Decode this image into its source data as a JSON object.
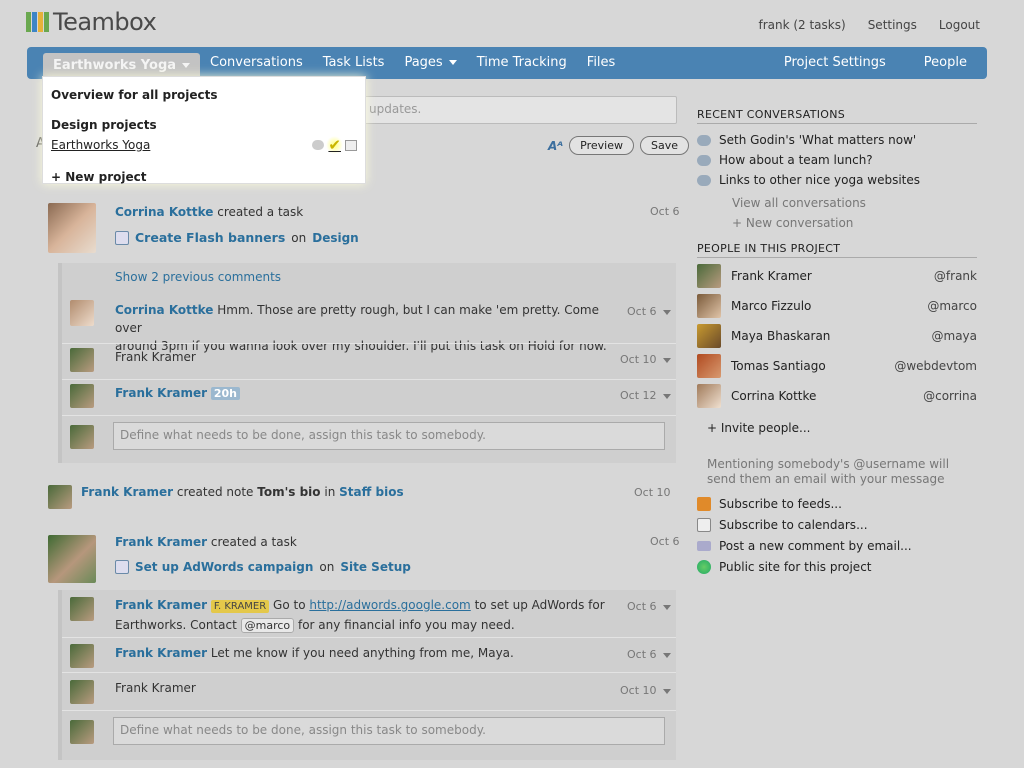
{
  "app": {
    "title": "Teambox"
  },
  "topnav": {
    "user": "frank (2 tasks)",
    "settings": "Settings",
    "logout": "Logout"
  },
  "nav": {
    "project": "Earthworks Yoga",
    "items": [
      "Conversations",
      "Task Lists",
      "Pages",
      "Time Tracking",
      "Files"
    ],
    "right": [
      "Project Settings",
      "People"
    ]
  },
  "dropdown": {
    "overview": "Overview for all projects",
    "group": "Design projects",
    "project": "Earthworks Yoga",
    "new_project": "+ New project"
  },
  "status_input": {
    "placeholder": "updates."
  },
  "buttons": {
    "aa": "Aᴬ",
    "preview": "Preview",
    "save": "Save"
  },
  "feed": {
    "a1": {
      "who": "Corrina Kottke",
      "action": "created a task",
      "date": "Oct 6",
      "task": "Create Flash banners",
      "on": "on",
      "project": "Design"
    },
    "a1_comments": {
      "show_prev": "Show 2 previous comments",
      "c1": {
        "who": "Corrina Kottke",
        "text": "Hmm. Those are pretty rough, but I can make 'em pretty. Come over",
        "text2": "around 3pm if you wanna look over my shoulder. I'll put this task on Hold for now.",
        "date": "Oct 6"
      },
      "c2": {
        "who": "Frank Kramer",
        "date": "Oct 10"
      },
      "c3": {
        "who": "Frank Kramer",
        "badge": "20h",
        "date": "Oct 12"
      },
      "placeholder": "Define what needs to be done, assign this task to somebody."
    },
    "a2": {
      "who": "Frank Kramer",
      "action": "created note",
      "note": "Tom's bio",
      "in": "in",
      "where": "Staff bios",
      "date": "Oct 10"
    },
    "a3": {
      "who": "Frank Kramer",
      "action": "created a task",
      "date": "Oct 6",
      "task": "Set up AdWords campaign",
      "on": "on",
      "project": "Site Setup"
    },
    "a3_comments": {
      "c1": {
        "who": "Frank Kramer",
        "tag": "F. KRAMER",
        "pre": "Go to",
        "link": "http://adwords.google.com",
        "post": "to set up AdWords for",
        "line2a": "Earthworks. Contact",
        "mention": "@marco",
        "line2b": "for any financial info you may need.",
        "date": "Oct 6"
      },
      "c2": {
        "who": "Frank Kramer",
        "text": "Let me know if you need anything from me, Maya.",
        "date": "Oct 6"
      },
      "c3": {
        "who": "Frank Kramer",
        "date": "Oct 10"
      },
      "placeholder": "Define what needs to be done, assign this task to somebody."
    }
  },
  "sidebar": {
    "recent_title": "RECENT CONVERSATIONS",
    "conversations": [
      "Seth Godin's 'What matters now'",
      "How about a team lunch?",
      "Links to other nice yoga websites"
    ],
    "view_all": "View all conversations",
    "new_conv": "+ New conversation",
    "people_title": "PEOPLE IN THIS PROJECT",
    "people": [
      {
        "name": "Frank Kramer",
        "user": "@frank"
      },
      {
        "name": "Marco Fizzulo",
        "user": "@marco"
      },
      {
        "name": "Maya Bhaskaran",
        "user": "@maya"
      },
      {
        "name": "Tomas Santiago",
        "user": "@webdevtom"
      },
      {
        "name": "Corrina Kottke",
        "user": "@corrina"
      }
    ],
    "invite": "+ Invite people...",
    "hint1": "Mentioning somebody's @username will",
    "hint2": "send them an email with your message",
    "links": [
      "Subscribe to feeds...",
      "Subscribe to calendars...",
      "Post a new comment by email...",
      "Public site for this project"
    ]
  },
  "colors": {
    "nav": "#4a83b3",
    "link": "#2a6f9c",
    "bg": "#d7d7d7"
  }
}
